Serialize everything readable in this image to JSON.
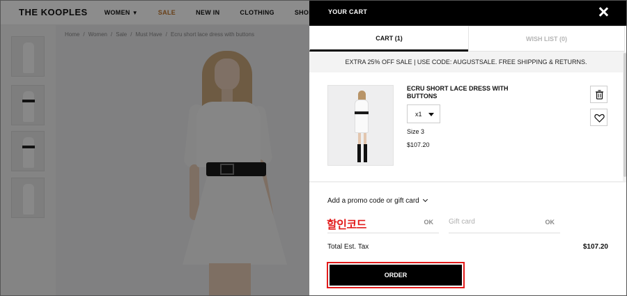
{
  "site": {
    "logo": "THE KOOPLES",
    "nav": [
      {
        "label": "WOMEN",
        "caret": "▼"
      },
      {
        "label": "SALE"
      },
      {
        "label": "NEW IN"
      },
      {
        "label": "CLOTHING"
      },
      {
        "label": "SHOES & ACCESS"
      }
    ],
    "breadcrumbs": [
      "Home",
      "Women",
      "Sale",
      "Must Have",
      "Ecru short lace dress with buttons"
    ],
    "breadcrumb_separator": "/"
  },
  "cart": {
    "title": "YOUR CART",
    "close_icon": "close-icon",
    "tabs": [
      {
        "label": "CART (1)",
        "active": true
      },
      {
        "label": "WISH LIST (0)",
        "active": false
      }
    ],
    "promo_banner": "EXTRA 25% OFF SALE | USE CODE: AUGUSTSALE. FREE SHIPPING & RETURNS.",
    "item": {
      "name": "ECRU SHORT LACE DRESS WITH BUTTONS",
      "quantity": "x1",
      "size": "Size 3",
      "price": "$107.20",
      "remove_icon": "trash-icon",
      "wishlist_icon": "heart-icon"
    },
    "promo_toggle": "Add a promo code or gift card",
    "promo_field": {
      "value": "",
      "placeholder": "",
      "ok": "OK"
    },
    "gift_field": {
      "value": "",
      "placeholder": "Gift card",
      "ok": "OK"
    },
    "annotation": "할인코드",
    "total_label": "Total Est. Tax",
    "total_value": "$107.20",
    "order_label": "ORDER"
  },
  "colors": {
    "accent_sale": "#c0762c",
    "highlight_red": "#e21b1b",
    "header_black": "#000000"
  }
}
